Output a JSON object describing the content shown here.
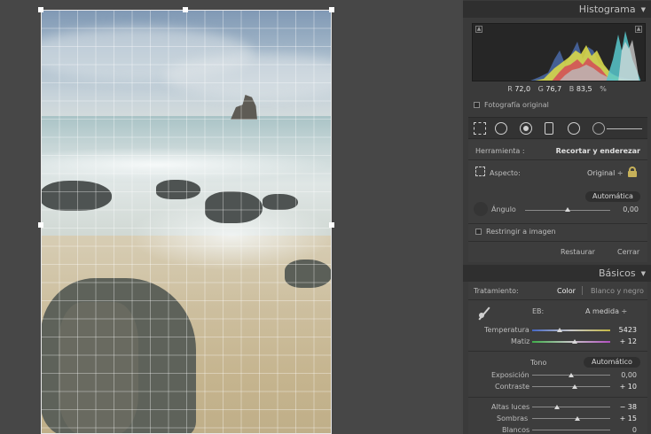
{
  "histogram": {
    "title": "Histograma",
    "r_label": "R",
    "r_value": "72,0",
    "g_label": "G",
    "g_value": "76,7",
    "b_label": "B",
    "b_value": "83,5",
    "pct": "%",
    "original_photo_label": "Fotografía original"
  },
  "crop": {
    "tool_label": "Herramienta :",
    "tool_name": "Recortar y enderezar",
    "aspect_label": "Aspecto:",
    "aspect_value": "Original ÷",
    "auto_button": "Automática",
    "angle_label": "Ángulo",
    "angle_value": "0,00",
    "constrain_label": "Restringir a imagen",
    "reset_button": "Restaurar",
    "close_button": "Cerrar",
    "angle_level": 0.5
  },
  "basic": {
    "title": "Básicos",
    "treatment_label": "Tratamiento:",
    "treatment_color": "Color",
    "treatment_bw": "Blanco y negro",
    "wb_label": "EB:",
    "wb_value": "A medida ÷",
    "temp_label": "Temperatura",
    "temp_value": "5423",
    "tint_label": "Matiz",
    "tint_value": "+ 12",
    "tone_label": "Tono",
    "tone_auto": "Automático",
    "exposure_label": "Exposición",
    "exposure_value": "0,00",
    "contrast_label": "Contraste",
    "contrast_value": "+ 10",
    "highlights_label": "Altas luces",
    "highlights_value": "− 38",
    "shadows_label": "Sombras",
    "shadows_value": "+ 15",
    "whites_label": "Blancos",
    "whites_value": "0"
  },
  "colors": {
    "panel_bg": "#3a3a3a",
    "header_bg": "#2f2f2f",
    "lock_color": "#c7b15a"
  },
  "icons": [
    "crop-overlay-icon",
    "spot-removal-icon",
    "red-eye-icon",
    "graduated-filter-icon",
    "radial-filter-icon",
    "adjustment-brush-icon",
    "lock-icon",
    "angle-tool-icon",
    "eyedropper-icon",
    "aspect-icon"
  ]
}
